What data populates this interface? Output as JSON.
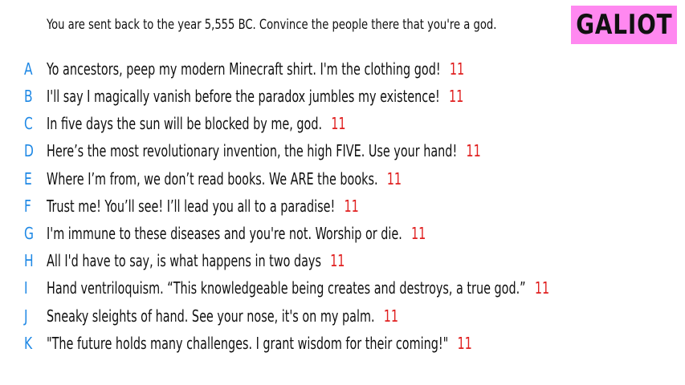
{
  "prompt": "You are sent back to the year 5,555 BC. Convince the people there that you're a god.",
  "player": {
    "name": "GALIOT",
    "badge_color": "#ff88f0"
  },
  "colors": {
    "letter": "#1e88e5",
    "score": "#e02020"
  },
  "answers": [
    {
      "letter": "A",
      "text": "Yo ancestors, peep my modern Minecraft shirt. I'm the clothing god!",
      "score": "11"
    },
    {
      "letter": "B",
      "text": "I'll say I magically vanish before the paradox jumbles my existence!",
      "score": "11"
    },
    {
      "letter": "C",
      "text": "In five days the sun will be blocked by me, god.",
      "score": "11"
    },
    {
      "letter": "D",
      "text": "Here’s the most revolutionary invention, the high FIVE. Use your hand!",
      "score": "11"
    },
    {
      "letter": "E",
      "text": "Where I’m from, we don’t read books. We ARE the books.",
      "score": "11"
    },
    {
      "letter": "F",
      "text": "Trust me! You’ll see! I’ll lead you all to a paradise!",
      "score": "11"
    },
    {
      "letter": "G",
      "text": "I'm immune to these diseases and you're not. Worship or die.",
      "score": "11"
    },
    {
      "letter": "H",
      "text": "All I'd have to say, is what happens in two days",
      "score": "11"
    },
    {
      "letter": "I",
      "text": "Hand ventriloquism. “This knowledgeable being creates and destroys, a true god.”",
      "score": "11"
    },
    {
      "letter": "J",
      "text": "Sneaky sleights of hand. See your nose, it's on my palm.",
      "score": "11"
    },
    {
      "letter": "K",
      "text": "\"The future holds many challenges. I grant wisdom for their coming!\"",
      "score": "11"
    }
  ]
}
